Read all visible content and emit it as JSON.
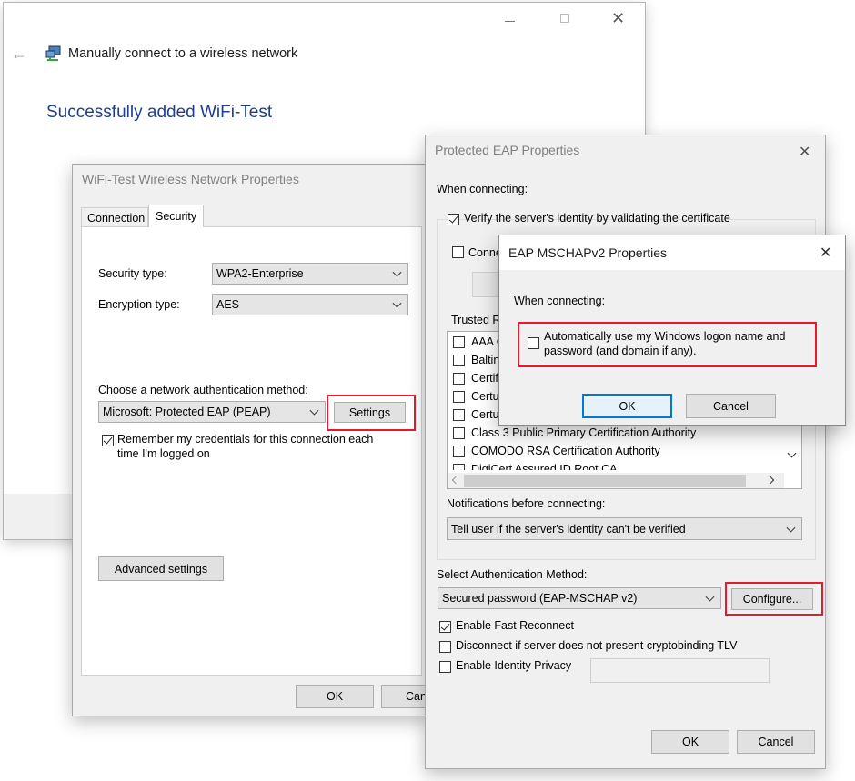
{
  "wizard": {
    "title": "Manually connect to a wireless network",
    "heading": "Successfully added WiFi-Test"
  },
  "props": {
    "title": "WiFi-Test Wireless Network Properties",
    "tabs": [
      "Connection",
      "Security"
    ],
    "security_type_label": "Security type:",
    "security_type_value": "WPA2-Enterprise",
    "encryption_type_label": "Encryption type:",
    "encryption_type_value": "AES",
    "auth_method_label": "Choose a network authentication method:",
    "auth_method_value": "Microsoft: Protected EAP (PEAP)",
    "settings_label": "Settings",
    "remember_line1": "Remember my credentials for this connection each",
    "remember_line2": "time I'm logged on",
    "advanced_label": "Advanced settings",
    "ok_label": "OK",
    "cancel_label": "Canc"
  },
  "peap": {
    "title": "Protected EAP Properties",
    "when_connecting": "When connecting:",
    "verify_label": "Verify the server's identity by validating the certificate",
    "connect_label": "Conne",
    "trusted_label": "Trusted R",
    "trusted_items": [
      "AAA C",
      "Baltim",
      "Certif",
      "Certu",
      "Certu",
      "Class 3 Public Primary Certification Authority",
      "COMODO RSA Certification Authority",
      "DigiCert Assured ID Root CA"
    ],
    "notifications_label": "Notifications before connecting:",
    "notifications_value": "Tell user if the server's identity can't be verified",
    "select_method_label": "Select Authentication Method:",
    "method_value": "Secured password (EAP-MSCHAP v2)",
    "configure_label": "Configure...",
    "fast_reconnect_label": "Enable Fast Reconnect",
    "disconnect_label": "Disconnect if server does not present cryptobinding TLV",
    "identity_privacy_label": "Enable Identity Privacy",
    "ok_label": "OK",
    "cancel_label": "Cancel"
  },
  "mschap": {
    "title": "EAP MSCHAPv2 Properties",
    "when_connecting": "When connecting:",
    "auto_line1": "Automatically use my Windows logon name and",
    "auto_line2": "password (and domain if any).",
    "ok_label": "OK",
    "cancel_label": "Cancel"
  },
  "colors": {
    "highlight": "#e8192c",
    "heading_blue": "#1e3f8f",
    "focus_blue": "#0078d7"
  }
}
